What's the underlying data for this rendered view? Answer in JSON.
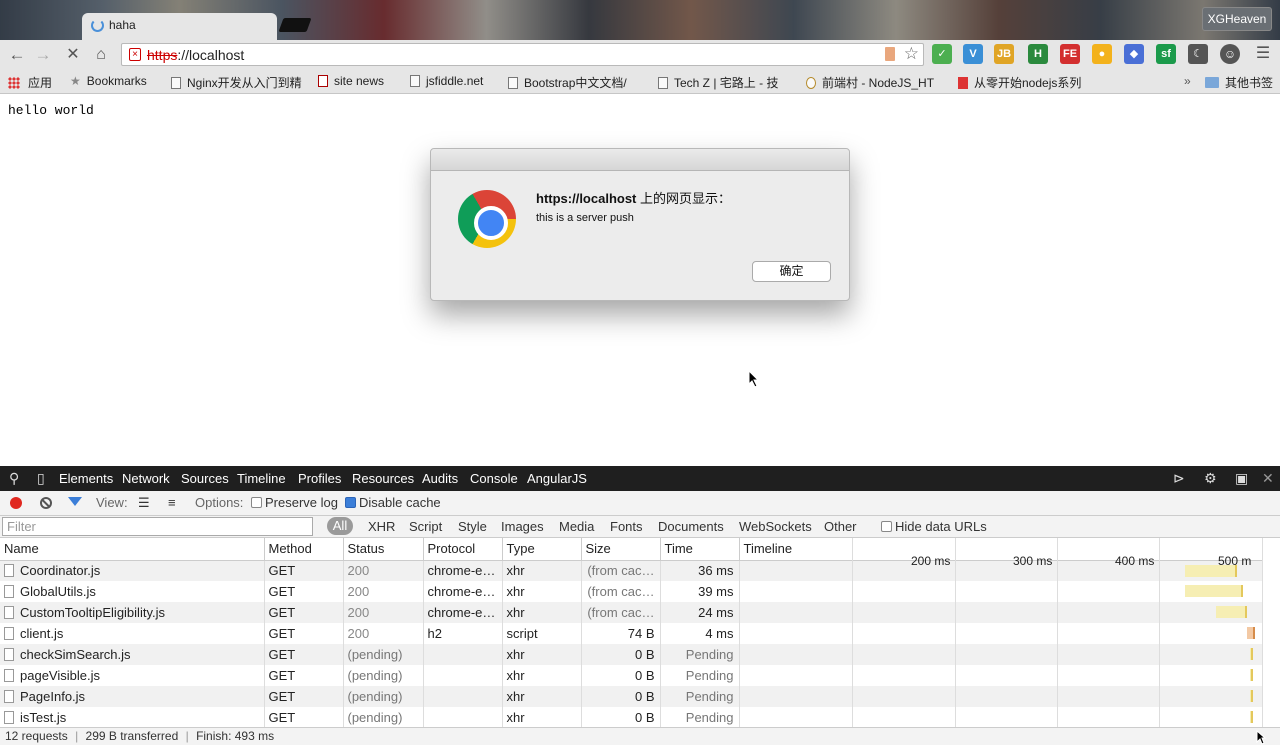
{
  "browser": {
    "tab_title": "haha",
    "profile_name": "XGHeaven",
    "url_scheme": "https",
    "url_rest": "://localhost",
    "bookmarks": [
      {
        "label": "应用"
      },
      {
        "label": "Bookmarks"
      },
      {
        "label": "Nginx开发从入门到精"
      },
      {
        "label": "site news"
      },
      {
        "label": "jsfiddle.net"
      },
      {
        "label": "Bootstrap中文文档/"
      },
      {
        "label": "Tech Z | 宅路上 - 技"
      },
      {
        "label": "前端村 - NodeJS_HT"
      },
      {
        "label": "从零开始nodejs系列"
      }
    ],
    "bookmarks_more": "»",
    "other_bookmarks": "其他书签",
    "extensions": [
      {
        "icon": "ext-check-icon",
        "glyph": "✓",
        "color": "#4caf50"
      },
      {
        "icon": "ext-v-icon",
        "glyph": "V",
        "color": "#3a8fd6"
      },
      {
        "icon": "ext-jb-icon",
        "glyph": "JB",
        "color": "#e0a526"
      },
      {
        "icon": "ext-h-icon",
        "glyph": "H",
        "color": "#2b8a3e"
      },
      {
        "icon": "ext-fe-icon",
        "glyph": "FE",
        "color": "#d32f2f"
      },
      {
        "icon": "ext-pear-icon",
        "glyph": "●",
        "color": "#f3b21c"
      },
      {
        "icon": "ext-tool-icon",
        "glyph": "◆",
        "color": "#4a6fd6"
      },
      {
        "icon": "ext-sf-icon",
        "glyph": "sf",
        "color": "#1b9a4b"
      },
      {
        "icon": "ext-moon-icon",
        "glyph": "☾",
        "color": "#555555"
      },
      {
        "icon": "ext-bot-icon",
        "glyph": "☺",
        "color": "#444444"
      }
    ]
  },
  "page": {
    "body_text": "hello world"
  },
  "alert": {
    "origin": "https://localhost",
    "title_suffix": " 上的网页显示：",
    "message": "this is a server push",
    "ok_label": "确定"
  },
  "devtools": {
    "tabs": [
      "Elements",
      "Network",
      "Sources",
      "Timeline",
      "Profiles",
      "Resources",
      "Audits",
      "Console",
      "AngularJS"
    ],
    "toolbar": {
      "view_label": "View:",
      "options_label": "Options:",
      "preserve_log": "Preserve log",
      "disable_cache": "Disable cache"
    },
    "filter_placeholder": "Filter",
    "filter_types": [
      "All",
      "XHR",
      "Script",
      "Style",
      "Images",
      "Media",
      "Fonts",
      "Documents",
      "WebSockets",
      "Other"
    ],
    "hide_data_urls": "Hide data URLs",
    "columns": [
      "Name",
      "Method",
      "Status",
      "Protocol",
      "Type",
      "Size",
      "Time",
      "Timeline"
    ],
    "timeline_ticks": [
      "200 ms",
      "300 ms",
      "400 ms",
      "500 m"
    ],
    "rows": [
      {
        "name": "Coordinator.js",
        "method": "GET",
        "status": "200",
        "protocol": "chrome-e…",
        "type": "xhr",
        "size": "(from cac…",
        "time": "36 ms",
        "bar": [
          0.85,
          0.95
        ]
      },
      {
        "name": "GlobalUtils.js",
        "method": "GET",
        "status": "200",
        "protocol": "chrome-e…",
        "type": "xhr",
        "size": "(from cac…",
        "time": "39 ms",
        "bar": [
          0.85,
          0.96
        ]
      },
      {
        "name": "CustomTooltipEligibility.js",
        "method": "GET",
        "status": "200",
        "protocol": "chrome-e…",
        "type": "xhr",
        "size": "(from cac…",
        "time": "24 ms",
        "bar": [
          0.91,
          0.97
        ]
      },
      {
        "name": "client.js",
        "method": "GET",
        "status": "200",
        "protocol": "h2",
        "type": "script",
        "size": "74 B",
        "time": "4 ms",
        "bar": [
          0.97,
          0.985
        ]
      },
      {
        "name": "checkSimSearch.js",
        "method": "GET",
        "status": "(pending)",
        "protocol": "",
        "type": "xhr",
        "size": "0 B",
        "time": "Pending",
        "bar": [
          0.975,
          0.98
        ]
      },
      {
        "name": "pageVisible.js",
        "method": "GET",
        "status": "(pending)",
        "protocol": "",
        "type": "xhr",
        "size": "0 B",
        "time": "Pending",
        "bar": [
          0.975,
          0.98
        ]
      },
      {
        "name": "PageInfo.js",
        "method": "GET",
        "status": "(pending)",
        "protocol": "",
        "type": "xhr",
        "size": "0 B",
        "time": "Pending",
        "bar": [
          0.975,
          0.98
        ]
      },
      {
        "name": "isTest.js",
        "method": "GET",
        "status": "(pending)",
        "protocol": "",
        "type": "xhr",
        "size": "0 B",
        "time": "Pending",
        "bar": [
          0.975,
          0.98
        ]
      }
    ],
    "status_requests": "12 requests",
    "status_transferred": "299 B transferred",
    "status_finish": "Finish: 493 ms"
  }
}
